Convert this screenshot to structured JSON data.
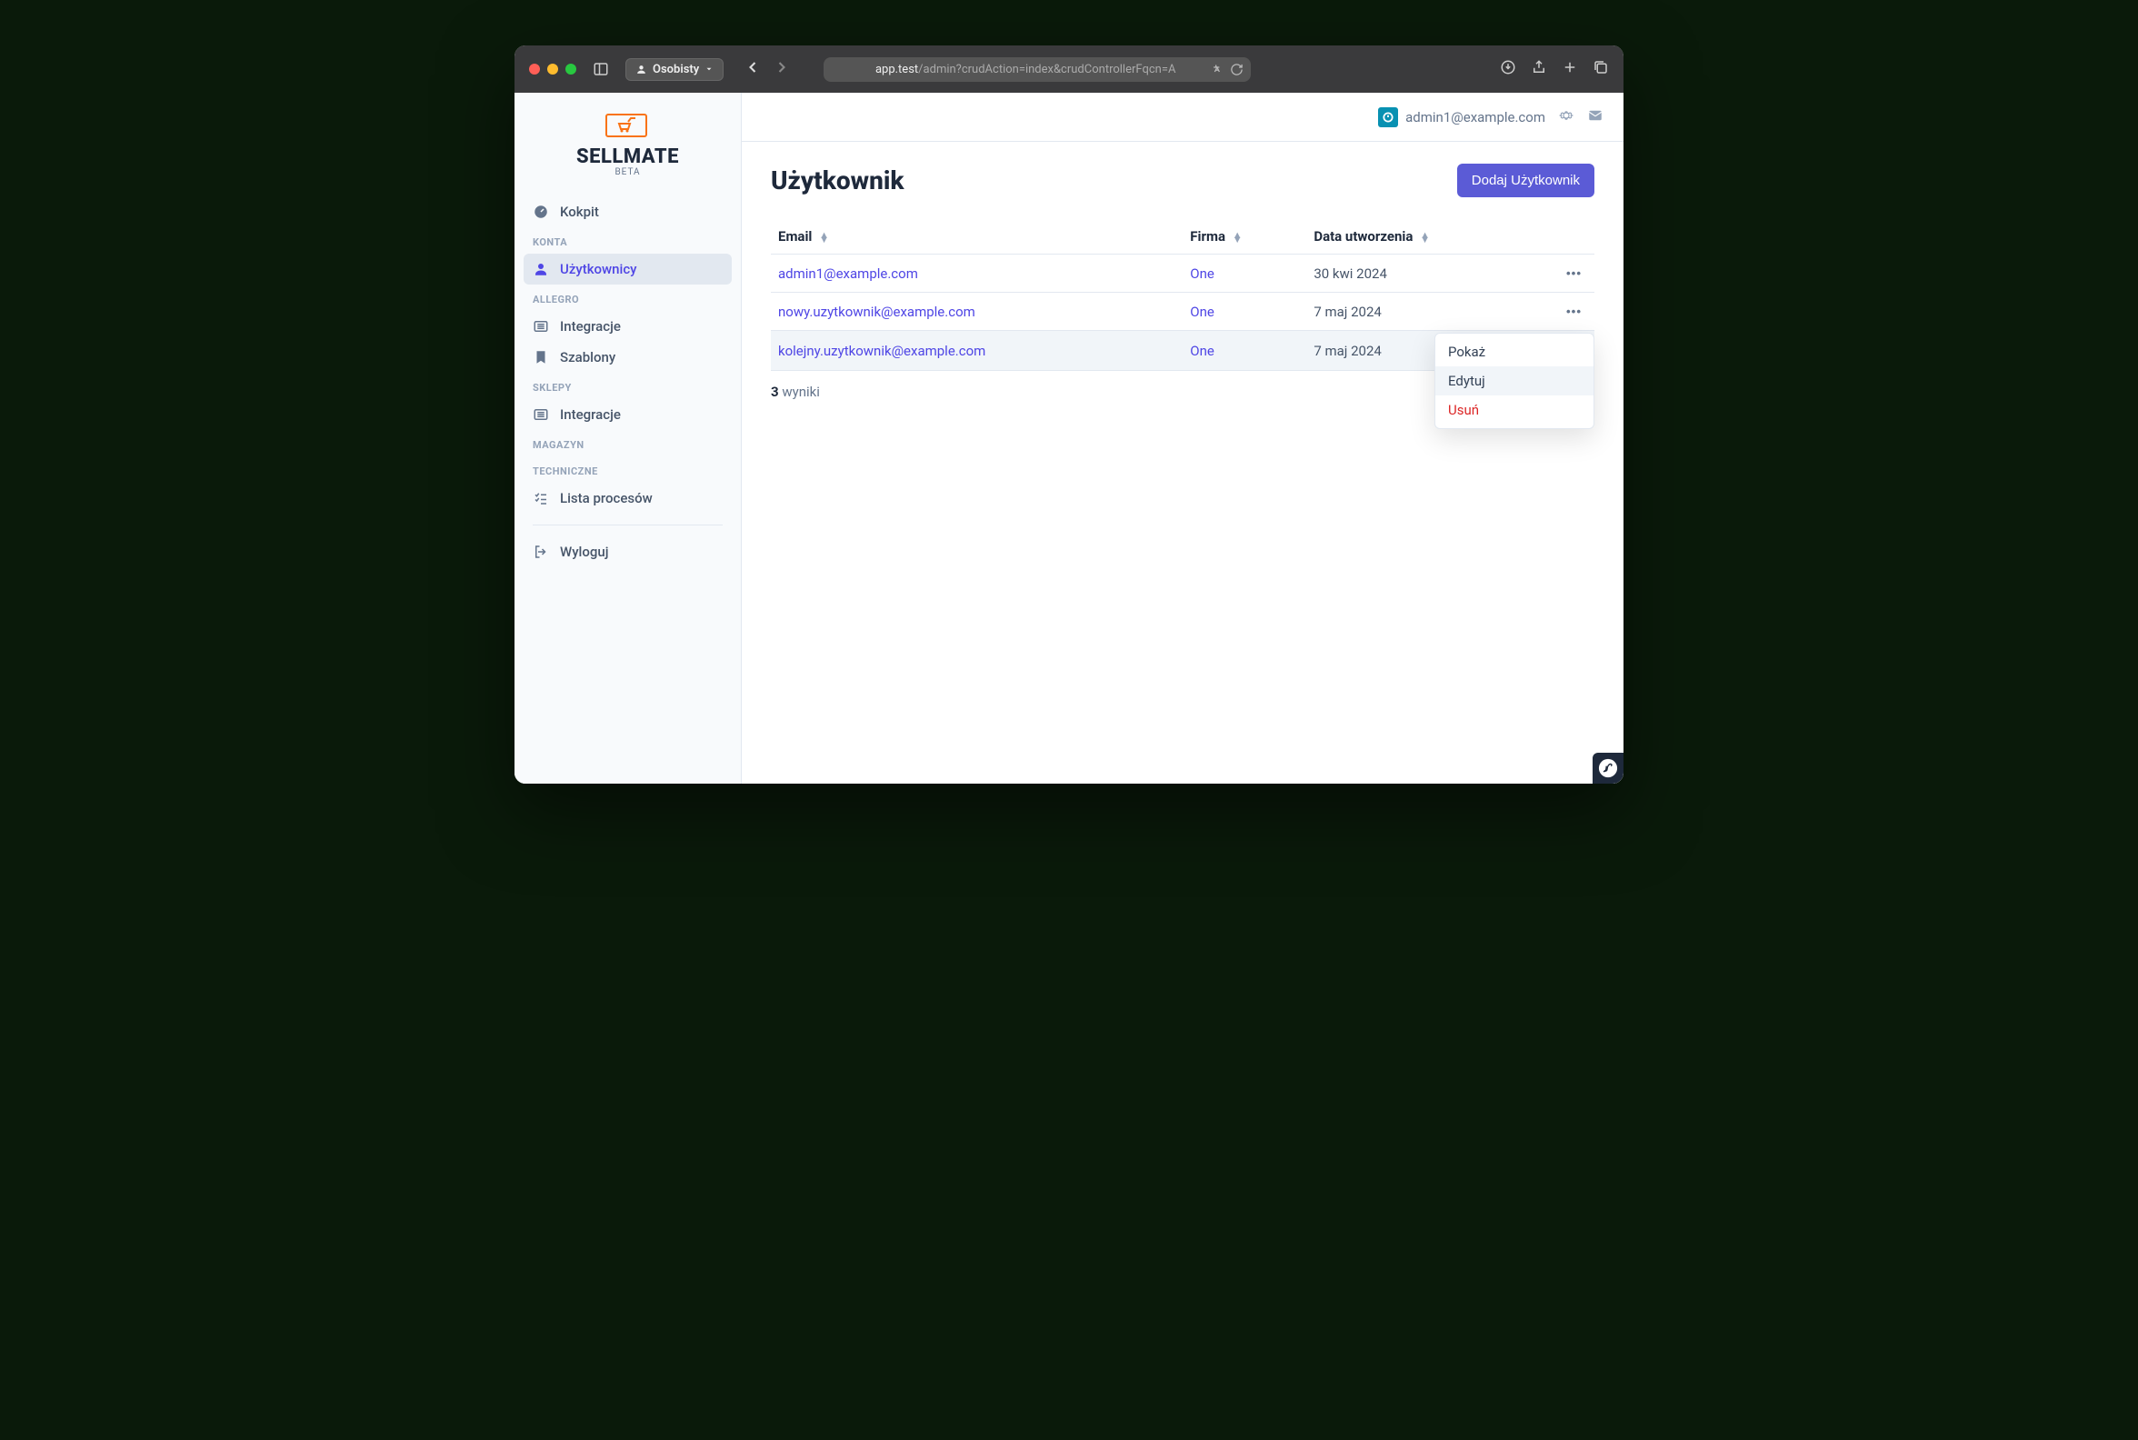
{
  "browser": {
    "profile_label": "Osobisty",
    "url_host": "app.test",
    "url_path": "/admin?crudAction=index&crudControllerFqcn=A"
  },
  "brand": {
    "name": "SELLMATE",
    "tag": "BETA"
  },
  "sidebar": {
    "item_cockpit": "Kokpit",
    "section_accounts": "KONTA",
    "item_users": "Użytkownicy",
    "section_allegro": "ALLEGRO",
    "item_integrations": "Integracje",
    "item_templates": "Szablony",
    "section_shops": "SKLEPY",
    "item_integrations2": "Integracje",
    "section_warehouse": "MAGAZYN",
    "section_technical": "TECHNICZNE",
    "item_processes": "Lista procesów",
    "item_logout": "Wyloguj"
  },
  "topbar": {
    "user_email": "admin1@example.com"
  },
  "page": {
    "title": "Użytkownik",
    "add_button": "Dodaj Użytkownik",
    "col_email": "Email",
    "col_company": "Firma",
    "col_created": "Data utworzenia",
    "results_count": "3",
    "results_label": "wyniki"
  },
  "rows": [
    {
      "email": "admin1@example.com",
      "company": "One",
      "created": "30 kwi 2024"
    },
    {
      "email": "nowy.uzytkownik@example.com",
      "company": "One",
      "created": "7 maj 2024"
    },
    {
      "email": "kolejny.uzytkownik@example.com",
      "company": "One",
      "created": "7 maj 2024"
    }
  ],
  "dropdown": {
    "show": "Pokaż",
    "edit": "Edytuj",
    "delete": "Usuń"
  }
}
